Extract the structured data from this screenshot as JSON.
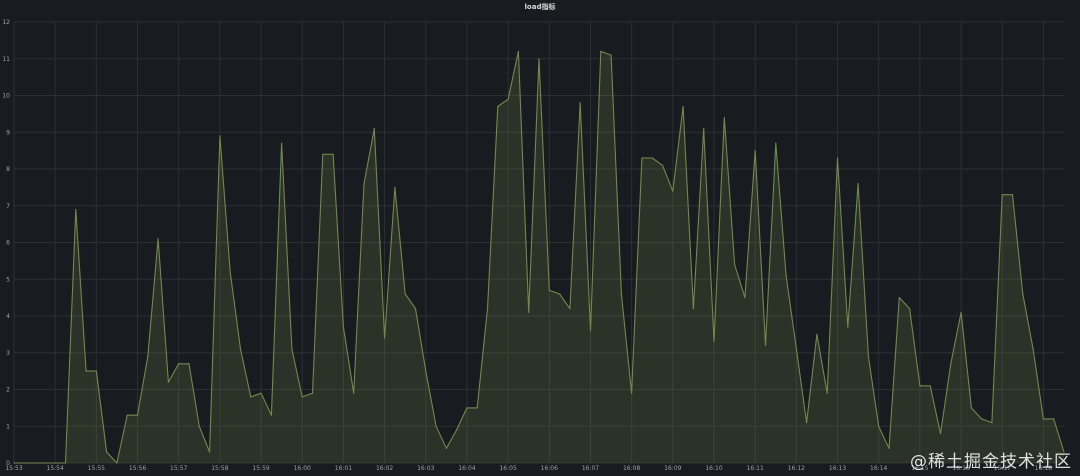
{
  "panel": {
    "title": "load指标"
  },
  "watermark": "@稀土掘金技术社区",
  "colors": {
    "background": "#181b1f",
    "grid": "#2c3033",
    "line": "#73884e",
    "fill": "#73884e"
  },
  "chart_data": {
    "type": "area",
    "title": "load指标",
    "xlabel": "",
    "ylabel": "",
    "ylim": [
      0,
      12
    ],
    "yticks": [
      0,
      1,
      2,
      3,
      4,
      5,
      6,
      7,
      8,
      9,
      10,
      11,
      12
    ],
    "xlim": [
      "15:53",
      "16:18:30"
    ],
    "xticks": [
      "15:53",
      "15:54",
      "15:55",
      "15:56",
      "15:57",
      "15:58",
      "15:59",
      "16:00",
      "16:01",
      "16:02",
      "16:03",
      "16:04",
      "16:05",
      "16:06",
      "16:07",
      "16:08",
      "16:09",
      "16:10",
      "16:11",
      "16:12",
      "16:13",
      "16:14",
      "16:15",
      "16:16",
      "16:17",
      "16:18"
    ],
    "grid": true,
    "legend": "none",
    "series": [
      {
        "x": [
          "15:53:00",
          "15:53:30",
          "15:54:00",
          "15:54:15",
          "15:54:30",
          "15:54:45",
          "15:55:00",
          "15:55:15",
          "15:55:30",
          "15:55:45",
          "15:56:00",
          "15:56:15",
          "15:56:30",
          "15:56:45",
          "15:57:00",
          "15:57:15",
          "15:57:30",
          "15:57:45",
          "15:58:00",
          "15:58:15",
          "15:58:30",
          "15:58:45",
          "15:59:00",
          "15:59:15",
          "15:59:30",
          "15:59:45",
          "16:00:00",
          "16:00:15",
          "16:00:30",
          "16:00:45",
          "16:01:00",
          "16:01:15",
          "16:01:30",
          "16:01:45",
          "16:02:00",
          "16:02:15",
          "16:02:30",
          "16:02:45",
          "16:03:00",
          "16:03:15",
          "16:03:30",
          "16:03:45",
          "16:04:00",
          "16:04:15",
          "16:04:30",
          "16:04:45",
          "16:05:00",
          "16:05:15",
          "16:05:30",
          "16:05:45",
          "16:06:00",
          "16:06:15",
          "16:06:30",
          "16:06:45",
          "16:07:00",
          "16:07:15",
          "16:07:30",
          "16:07:45",
          "16:08:00",
          "16:08:15",
          "16:08:30",
          "16:08:45",
          "16:09:00",
          "16:09:15",
          "16:09:30",
          "16:09:45",
          "16:10:00",
          "16:10:15",
          "16:10:30",
          "16:10:45",
          "16:11:00",
          "16:11:15",
          "16:11:30",
          "16:11:45",
          "16:12:00",
          "16:12:15",
          "16:12:30",
          "16:12:45",
          "16:13:00",
          "16:13:15",
          "16:13:30",
          "16:13:45",
          "16:14:00",
          "16:14:15",
          "16:14:30",
          "16:14:45",
          "16:15:00",
          "16:15:15",
          "16:15:30",
          "16:15:45",
          "16:16:00",
          "16:16:15",
          "16:16:30",
          "16:16:45",
          "16:17:00",
          "16:17:15",
          "16:17:30",
          "16:17:45",
          "16:18:00",
          "16:18:15",
          "16:18:30"
        ],
        "values": [
          0,
          0,
          0,
          0,
          6.9,
          2.5,
          2.5,
          0.3,
          0,
          1.3,
          1.3,
          2.9,
          6.1,
          2.2,
          2.7,
          2.7,
          1.0,
          0.3,
          8.9,
          5.2,
          3.1,
          1.8,
          1.9,
          1.3,
          8.7,
          3.1,
          1.8,
          1.9,
          8.4,
          8.4,
          3.7,
          1.9,
          7.6,
          9.1,
          3.4,
          7.5,
          4.6,
          4.2,
          2.5,
          1.0,
          0.4,
          0.9,
          1.5,
          1.5,
          4.2,
          9.7,
          9.9,
          11.2,
          4.1,
          11.0,
          4.7,
          4.6,
          4.2,
          9.8,
          3.6,
          11.2,
          11.1,
          4.6,
          1.9,
          8.3,
          8.3,
          8.1,
          7.4,
          9.7,
          4.2,
          9.1,
          3.3,
          9.4,
          5.4,
          4.5,
          8.5,
          3.2,
          8.7,
          5.1,
          3.1,
          1.1,
          3.5,
          1.9,
          8.3,
          3.7,
          7.6,
          2.9,
          1.0,
          0.4,
          4.5,
          4.2,
          2.1,
          2.1,
          0.8,
          2.7,
          4.1,
          1.5,
          1.2,
          1.1,
          7.3,
          7.3,
          4.6,
          3.1,
          1.2,
          1.2,
          0.3
        ]
      }
    ]
  }
}
